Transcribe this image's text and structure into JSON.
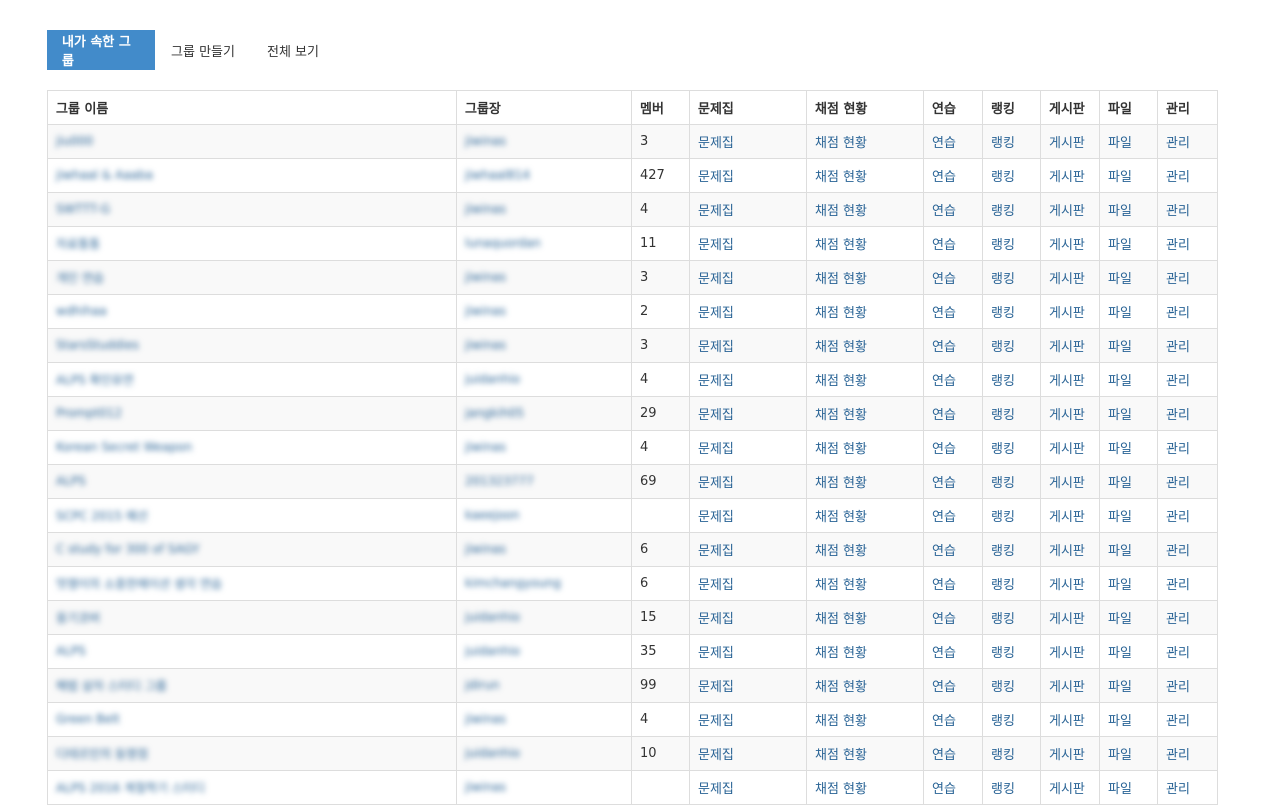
{
  "tabs": [
    {
      "label": "내가 속한 그룹",
      "active": true
    },
    {
      "label": "그룹 만들기",
      "active": false
    },
    {
      "label": "전체 보기",
      "active": false
    }
  ],
  "table": {
    "headers": [
      "그룹 이름",
      "그룹장",
      "멤버",
      "문제집",
      "채점 현황",
      "연습",
      "랭킹",
      "게시판",
      "파일",
      "관리"
    ],
    "link_labels": {
      "workbook": "문제집",
      "status": "채점 현황",
      "practice": "연습",
      "ranking": "랭킹",
      "board": "게시판",
      "files": "파일",
      "manage": "관리"
    },
    "rows": [
      {
        "name": "jiu000",
        "leader": "jiwinas",
        "members": "3"
      },
      {
        "name": "jiwhaal & Aaaba",
        "leader": "jiwhaal814",
        "members": "427"
      },
      {
        "name": "SWTTT-G",
        "leader": "jiwinas",
        "members": "4"
      },
      {
        "name": "자료통통",
        "leader": "lunaquordan",
        "members": "11"
      },
      {
        "name": "개인 연습",
        "leader": "jiwinas",
        "members": "3"
      },
      {
        "name": "wdhihaa",
        "leader": "jiwinas",
        "members": "2"
      },
      {
        "name": "StarsStuddies",
        "leader": "jiwinas",
        "members": "3"
      },
      {
        "name": "ALPS 확인유연",
        "leader": "juidanhio",
        "members": "4"
      },
      {
        "name": "Prompt012",
        "leader": "jangkih05",
        "members": "29"
      },
      {
        "name": "Korean Secret Weapon",
        "leader": "jiwinas",
        "members": "4"
      },
      {
        "name": "ALPS",
        "leader": "201323777",
        "members": "69"
      },
      {
        "name": "SCPC 2015 예선",
        "leader": "kaeejoon",
        "members": ""
      },
      {
        "name": "C study for 300 of SAGY",
        "leader": "jiwinas",
        "members": "6"
      },
      {
        "name": "멋쟁이의 소중한메이션 생각 연습",
        "leader": "kimchangyoung",
        "members": "6"
      },
      {
        "name": "웅기코버",
        "leader": "juidanhio",
        "members": "15"
      },
      {
        "name": "ALPS",
        "leader": "juidanhio",
        "members": "35"
      },
      {
        "name": "해법 살자 스터디 그룹",
        "leader": "jdirun",
        "members": "99"
      },
      {
        "name": "Green Belt",
        "leader": "jiwinas",
        "members": "4"
      },
      {
        "name": "디테르민의 동명점",
        "leader": "juidanhio",
        "members": "10"
      },
      {
        "name": "ALPS 2016 계절학기 스터디",
        "leader": "jiwinas",
        "members": ""
      }
    ]
  }
}
